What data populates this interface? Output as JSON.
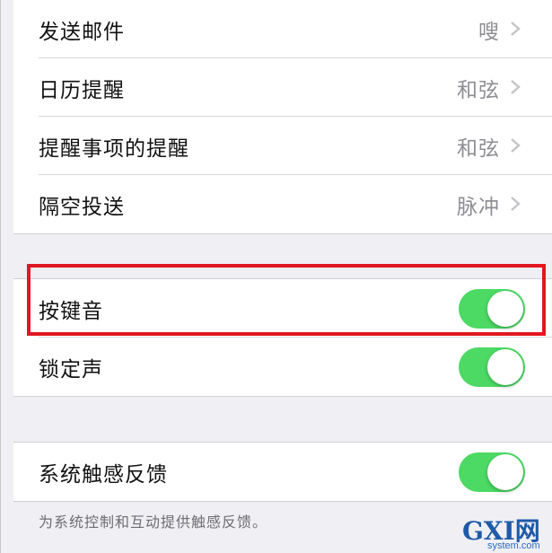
{
  "rows_group1": [
    {
      "label": "发送邮件",
      "value": "嗖"
    },
    {
      "label": "日历提醒",
      "value": "和弦"
    },
    {
      "label": "提醒事项的提醒",
      "value": "和弦"
    },
    {
      "label": "隔空投送",
      "value": "脉冲"
    }
  ],
  "rows_group2": [
    {
      "label": "按键音",
      "on": true
    },
    {
      "label": "锁定声",
      "on": true
    }
  ],
  "rows_group3": [
    {
      "label": "系统触感反馈",
      "on": true
    }
  ],
  "footer_note": "为系统控制和互动提供触感反馈。",
  "watermark": {
    "top": "GXI网",
    "bottom": "system.com"
  },
  "colors": {
    "toggle_on": "#4cd964",
    "highlight_border": "#e0181f",
    "background": "#efeff4"
  }
}
